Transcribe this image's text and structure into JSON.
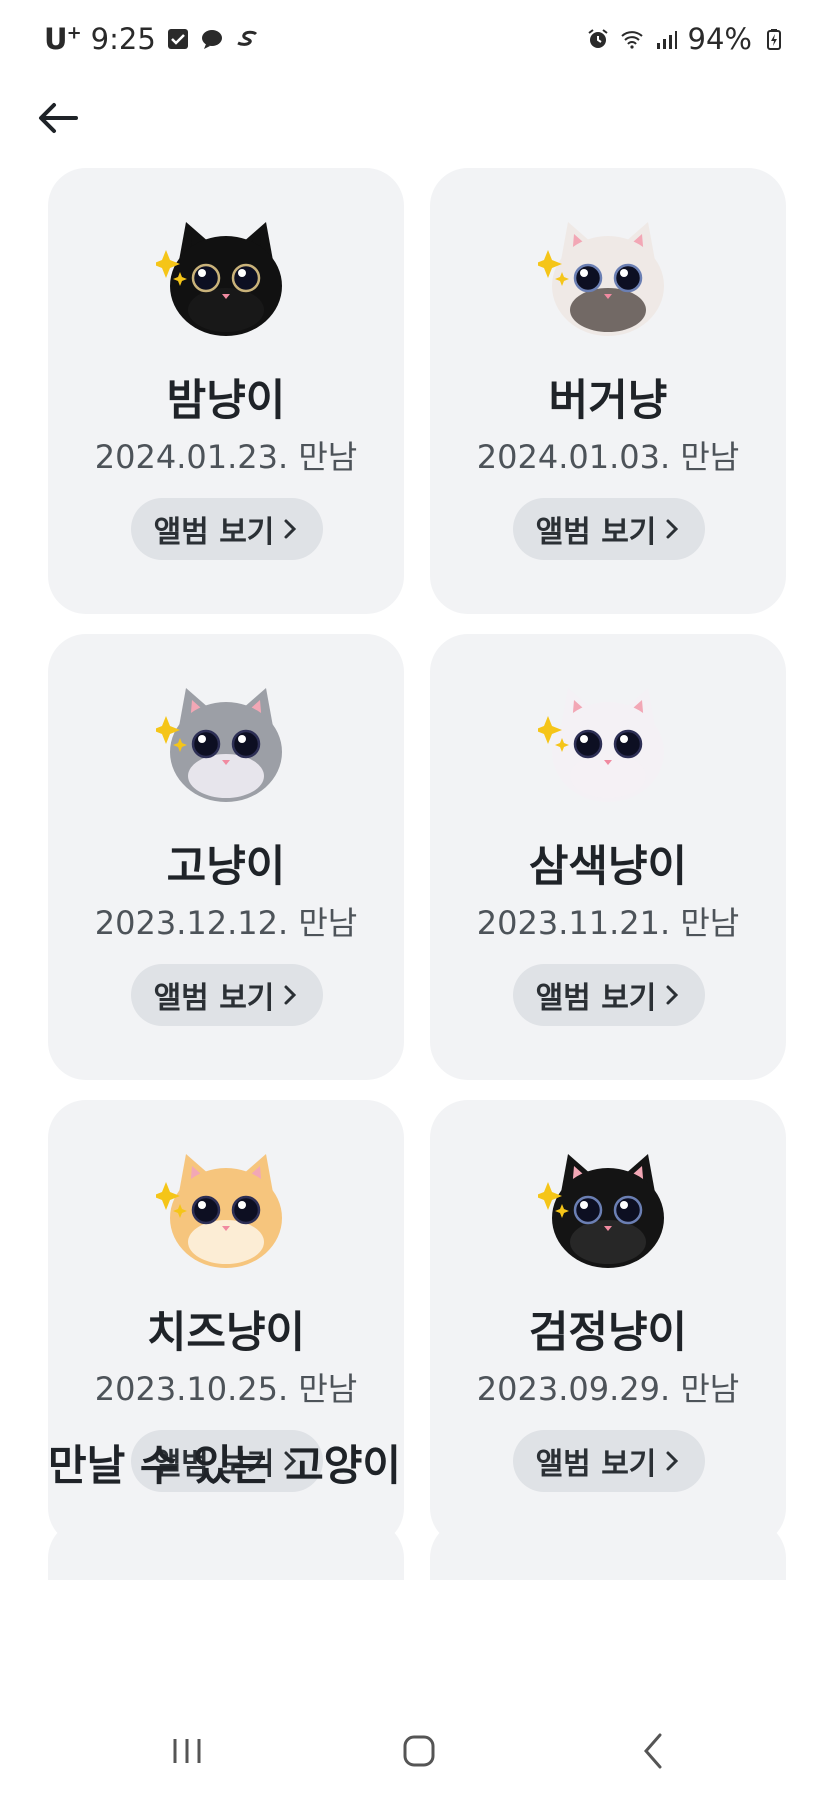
{
  "status": {
    "carrier": "U",
    "carrier_sup": "+",
    "time": "9:25",
    "battery": "94%"
  },
  "header": {
    "back_icon": "arrow-left-icon"
  },
  "cats": [
    {
      "name": "밤냥이",
      "date": "2024.01.23. 만남",
      "album_label": "앨범 보기",
      "fur": "#111111",
      "face": "#1a1a1a",
      "ear": "#111111",
      "eye_ring": "#c9b27a"
    },
    {
      "name": "버거냥",
      "date": "2024.01.03. 만남",
      "album_label": "앨범 보기",
      "fur": "#efe9e6",
      "face": "#5c524d",
      "ear": "#f2a7b5",
      "eye_ring": "#6b7fb3"
    },
    {
      "name": "고냥이",
      "date": "2023.12.12. 만남",
      "album_label": "앨범 보기",
      "fur": "#9c9fa6",
      "face": "#f4f1f8",
      "ear": "#f2a7b5",
      "eye_ring": "#2d2f55"
    },
    {
      "name": "삼색냥이",
      "date": "2023.11.21. 만남",
      "album_label": "앨범 보기",
      "fur": "#f4f1f5",
      "face": "#f4f1f5",
      "ear": "#f2a7b5",
      "eye_ring": "#2d2f55"
    },
    {
      "name": "치즈냥이",
      "date": "2023.10.25. 만남",
      "album_label": "앨범 보기",
      "fur": "#f6c57d",
      "face": "#fdf3e4",
      "ear": "#f2a7b5",
      "eye_ring": "#2d2f55"
    },
    {
      "name": "검정냥이",
      "date": "2023.09.29. 만남",
      "album_label": "앨범 보기",
      "fur": "#141414",
      "face": "#2a2a2a",
      "ear": "#f2a7b5",
      "eye_ring": "#6b7fb3"
    }
  ],
  "section": {
    "title": "만날 수 있는 고양이"
  },
  "colors": {
    "card_bg": "#f2f3f5",
    "button_bg": "#dfe2e6",
    "sparkle": "#f5c518"
  }
}
